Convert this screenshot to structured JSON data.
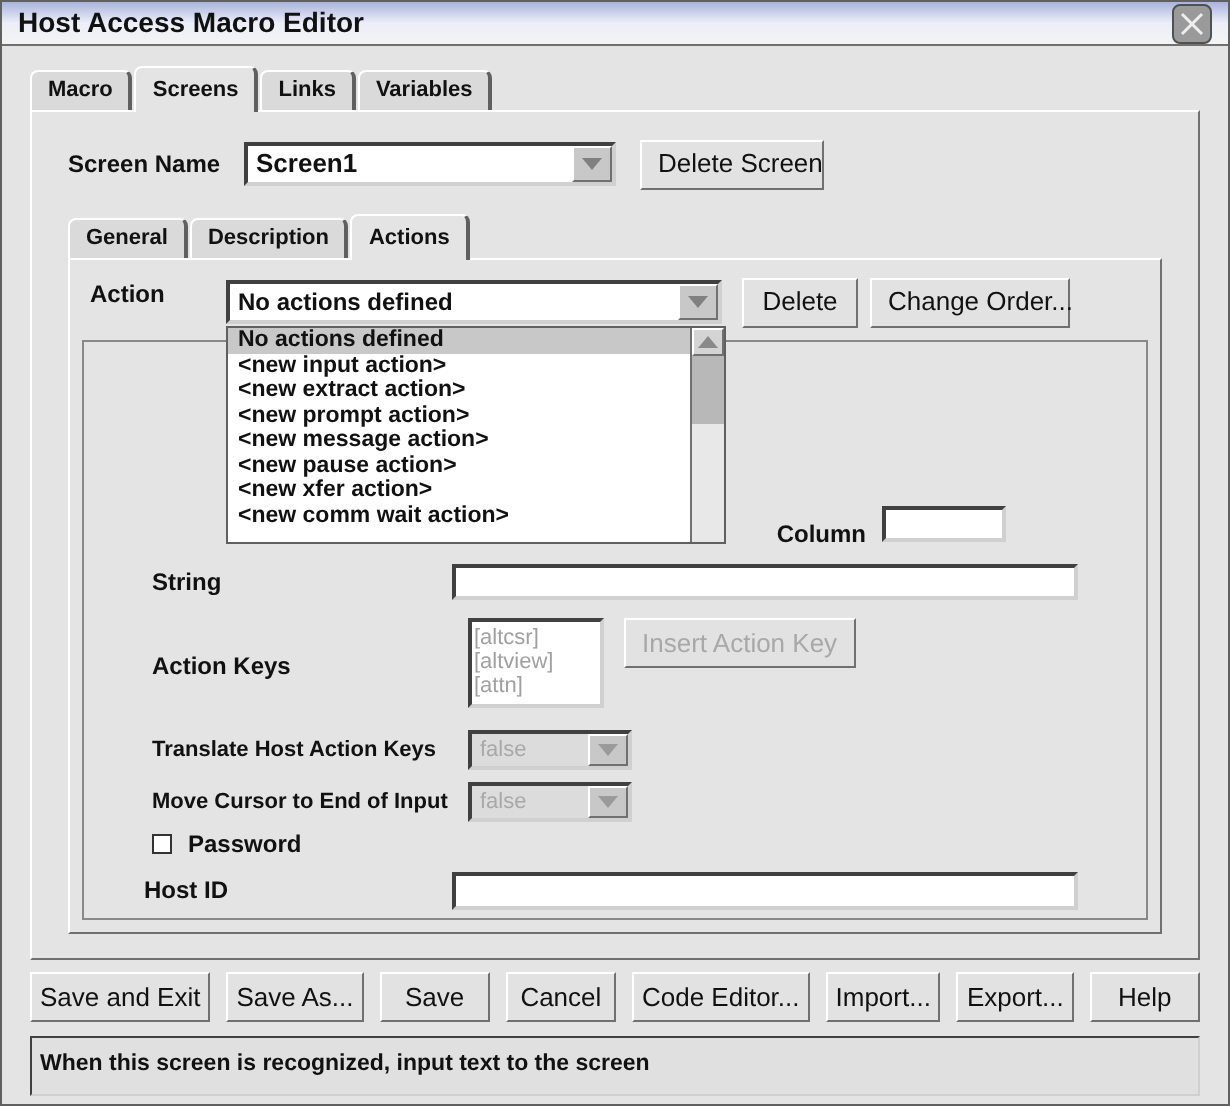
{
  "window": {
    "title": "Host Access Macro Editor"
  },
  "tabs": [
    {
      "label": "Macro",
      "selected": false
    },
    {
      "label": "Screens",
      "selected": true
    },
    {
      "label": "Links",
      "selected": false
    },
    {
      "label": "Variables",
      "selected": false
    }
  ],
  "screen_name": {
    "label": "Screen Name",
    "value": "Screen1"
  },
  "delete_screen_button": "Delete Screen",
  "inner_tabs": [
    {
      "label": "General",
      "selected": false
    },
    {
      "label": "Description",
      "selected": false
    },
    {
      "label": "Actions",
      "selected": true
    }
  ],
  "action": {
    "label": "Action",
    "value": "No actions defined",
    "delete_button": "Delete",
    "change_order_button": "Change Order...",
    "list": [
      {
        "label": "No actions defined",
        "selected": true
      },
      {
        "label": "<new input action>",
        "selected": false
      },
      {
        "label": "<new extract action>",
        "selected": false
      },
      {
        "label": "<new prompt action>",
        "selected": false
      },
      {
        "label": "<new message action>",
        "selected": false
      },
      {
        "label": "<new pause action>",
        "selected": false
      },
      {
        "label": "<new xfer action>",
        "selected": false
      },
      {
        "label": "<new comm wait action>",
        "selected": false
      }
    ]
  },
  "column": {
    "label": "Column"
  },
  "string": {
    "label": "String"
  },
  "action_keys": {
    "label": "Action Keys",
    "items": [
      "[altcsr]",
      "[altview]",
      "[attn]"
    ],
    "button": "Insert Action Key",
    "disabled": true
  },
  "translate": {
    "label": "Translate Host Action Keys",
    "value": "false",
    "disabled": true
  },
  "move_cursor": {
    "label": "Move Cursor to End of Input",
    "value": "false",
    "disabled": true
  },
  "password": {
    "label": "Password",
    "checked": false
  },
  "host_id": {
    "label": "Host ID"
  },
  "buttons": [
    "Save and Exit",
    "Save As...",
    "Save",
    "Cancel",
    "Code Editor...",
    "Import...",
    "Export...",
    "Help"
  ],
  "status_bar": "When this screen is recognized, input text to the screen"
}
